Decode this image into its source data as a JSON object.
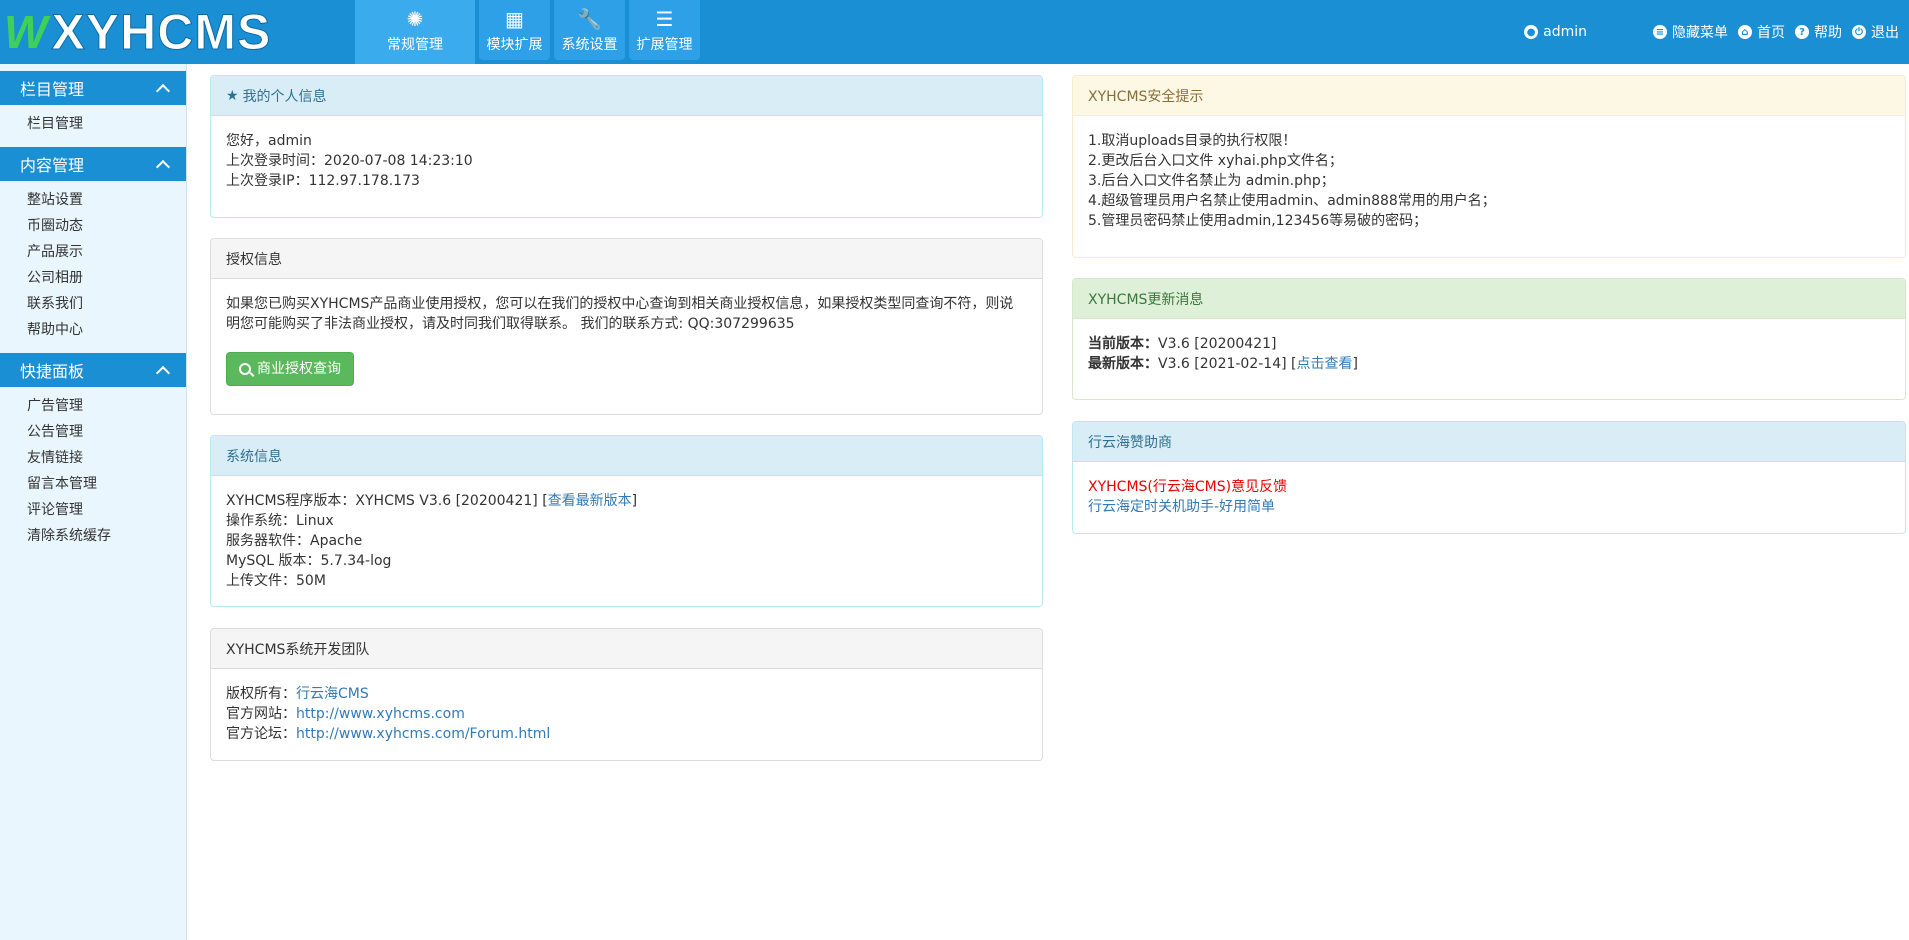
{
  "header": {
    "logo_mark": "W",
    "logo_text": "XYHCMS",
    "nav": [
      {
        "label": "常规管理",
        "icon": "cog-sun-icon"
      },
      {
        "label": "模块扩展",
        "icon": "grid-icon"
      },
      {
        "label": "系统设置",
        "icon": "wrench-icon"
      },
      {
        "label": "扩展管理",
        "icon": "list-icon"
      }
    ],
    "user": "admin",
    "links": [
      "隐藏菜单",
      "首页",
      "帮助",
      "退出"
    ]
  },
  "sidebar": {
    "sections": [
      {
        "title": "栏目管理",
        "items": [
          "栏目管理"
        ]
      },
      {
        "title": "内容管理",
        "items": [
          "整站设置",
          "币圈动态",
          "产品展示",
          "公司相册",
          "联系我们",
          "帮助中心"
        ]
      },
      {
        "title": "快捷面板",
        "items": [
          "广告管理",
          "公告管理",
          "友情链接",
          "留言本管理",
          "评论管理",
          "清除系统缓存"
        ]
      }
    ]
  },
  "personal": {
    "title": "我的个人信息",
    "greeting": "您好，admin",
    "last_login_time": "上次登录时间：2020-07-08 14:23:10",
    "last_login_ip": "上次登录IP：112.97.178.173"
  },
  "auth": {
    "title": "授权信息",
    "text_line1": "如果您已购买XYHCMS产品商业使用授权，您可以在我们的授权中心查询到相关商业授权信息，如果授权类型同查询不符，则说",
    "text_line2": "明您可能购买了非法商业授权，请及时同我们取得联系。 我们的联系方式: QQ:307299635",
    "button": "商业授权查询"
  },
  "sysinfo": {
    "title": "系统信息",
    "version_label": "XYHCMS程序版本：XYHCMS V3.6 [20200421] [",
    "version_link": "查看最新版本",
    "version_end": "]",
    "os": "操作系统：Linux",
    "server": "服务器软件：Apache",
    "mysql": "MySQL 版本：5.7.34-log",
    "upload": "上传文件：50M"
  },
  "team": {
    "title": "XYHCMS系统开发团队",
    "copyright_label": "版权所有：",
    "copyright_link": "行云海CMS",
    "site_label": "官方网站：",
    "site_link": "http://www.xyhcms.com",
    "forum_label": "官方论坛：",
    "forum_link": "http://www.xyhcms.com/Forum.html"
  },
  "security": {
    "title": "XYHCMS安全提示",
    "lines": [
      "1.取消uploads目录的执行权限！",
      "2.更改后台入口文件 xyhai.php文件名；",
      "3.后台入口文件名禁止为 admin.php；",
      "4.超级管理员用户名禁止使用admin、admin888常用的用户名；",
      "5.管理员密码禁止使用admin,123456等易破的密码；"
    ]
  },
  "update": {
    "title": "XYHCMS更新消息",
    "current_label": "当前版本：",
    "current_value": "V3.6 [20200421]",
    "latest_label": "最新版本：",
    "latest_value": "V3.6 [2021-02-14] [",
    "latest_link": "点击查看",
    "latest_end": "]"
  },
  "sponsor": {
    "title": "行云海赞助商",
    "link1": "XYHCMS(行云海CMS)意见反馈",
    "link2": "行云海定时关机助手-好用简单"
  },
  "colors": {
    "header": "#1a8fd4",
    "sidebar": "#e9f6fd",
    "link": "#337ab7",
    "button": "#5cb85c"
  }
}
